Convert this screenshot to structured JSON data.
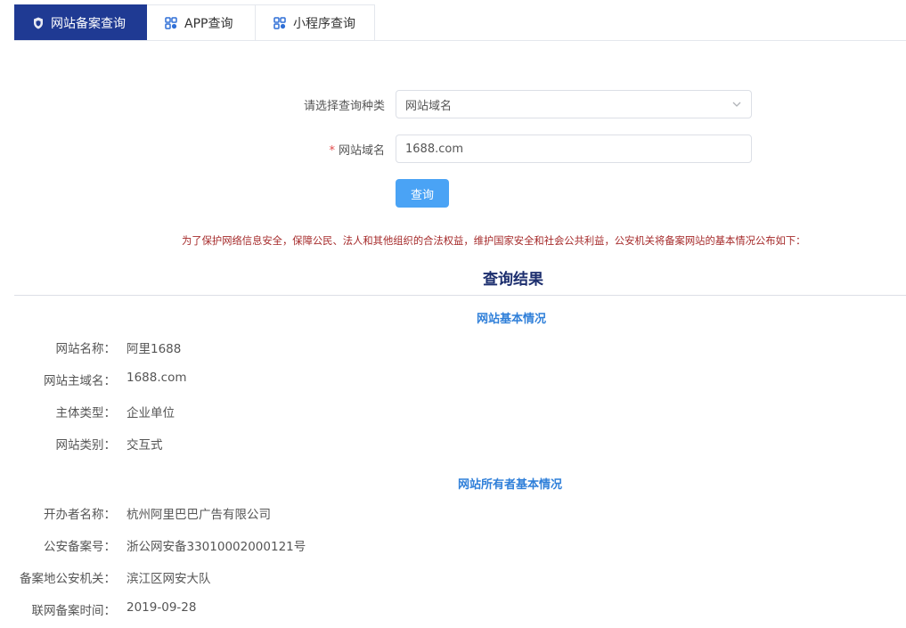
{
  "tabs": [
    {
      "label": "网站备案查询",
      "active": true,
      "icon": "shield-icon"
    },
    {
      "label": "APP查询",
      "active": false,
      "icon": "apps-grid-icon"
    },
    {
      "label": "小程序查询",
      "active": false,
      "icon": "apps-grid-icon"
    }
  ],
  "form": {
    "category_label": "请选择查询种类",
    "category_value": "网站域名",
    "domain_required_mark": "*",
    "domain_label": "网站域名",
    "domain_value": "1688.com",
    "query_button": "查询"
  },
  "notice": "为了保护网络信息安全，保障公民、法人和其他组织的合法权益，维护国家安全和社会公共利益，公安机关将备案网站的基本情况公布如下：",
  "result_title": "查询结果",
  "site_section": {
    "title": "网站基本情况",
    "rows": [
      {
        "key": "网站名称：",
        "value": "阿里1688"
      },
      {
        "key": "网站主域名：",
        "value": "1688.com"
      },
      {
        "key": "主体类型：",
        "value": "企业单位"
      },
      {
        "key": "网站类别：",
        "value": "交互式"
      }
    ]
  },
  "owner_section": {
    "title": "网站所有者基本情况",
    "rows": [
      {
        "key": "开办者名称：",
        "value": "杭州阿里巴巴广告有限公司"
      },
      {
        "key": "公安备案号：",
        "value": "浙公网安备33010002000121号"
      },
      {
        "key": "备案地公安机关：",
        "value": "滨江区网安大队"
      },
      {
        "key": "联网备案时间：",
        "value": "2019-09-28"
      }
    ]
  },
  "colors": {
    "tab_active": "#1f3a93",
    "button": "#4aa3f5",
    "notice": "#a52a2a",
    "section": "#2f7fd9"
  }
}
